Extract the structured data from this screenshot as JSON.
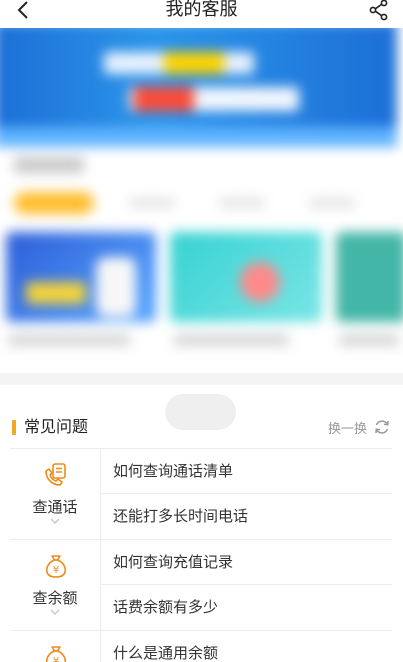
{
  "header": {
    "title": "我的客服"
  },
  "faq": {
    "title": "常见问题",
    "swap_label": "换一换",
    "categories": [
      {
        "label": "查通话",
        "icon": "phone-bill-icon",
        "questions": [
          "如何查询通话清单",
          "还能打多长时间电话"
        ]
      },
      {
        "label": "查余额",
        "icon": "money-bag-icon",
        "questions": [
          "如何查询充值记录",
          "话费余额有多少"
        ]
      },
      {
        "label": "",
        "icon": "money-bag-icon",
        "questions": [
          "什么是通用余额"
        ]
      }
    ]
  },
  "colors": {
    "accent": "#f5a623",
    "icon_orange": "#f08a1c",
    "divider": "#ececec",
    "band": "#f4f4f4"
  }
}
